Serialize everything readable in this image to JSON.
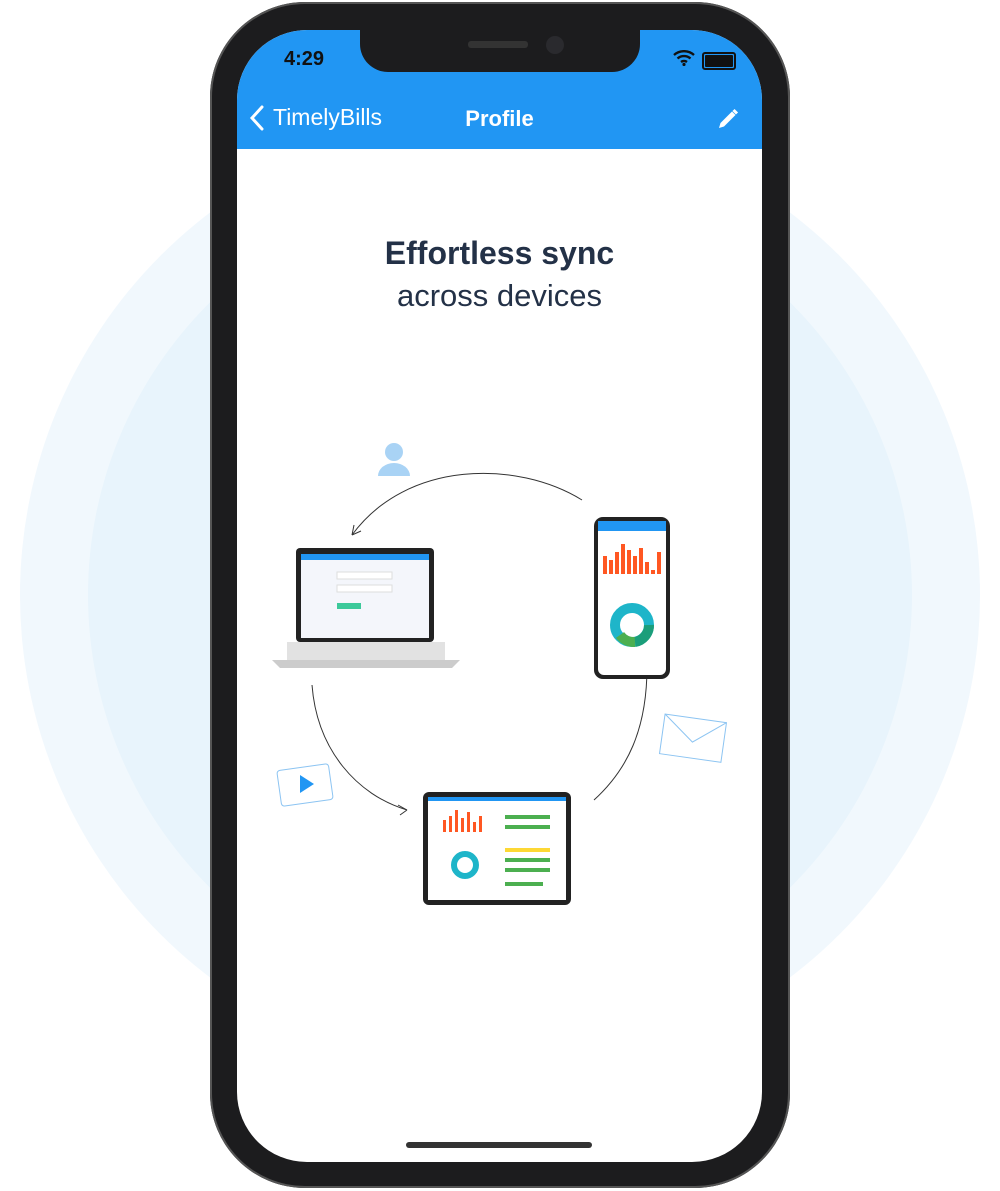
{
  "status_bar": {
    "time": "4:29"
  },
  "nav": {
    "back_label": "TimelyBills",
    "title": "Profile",
    "edit_icon": "pencil-icon"
  },
  "content": {
    "headline": "Effortless sync",
    "subheadline": "across devices"
  },
  "colors": {
    "header": "#2196F3",
    "text": "#233147",
    "accent_bar": "#FF5722",
    "donut_teal": "#1EB5C9"
  }
}
